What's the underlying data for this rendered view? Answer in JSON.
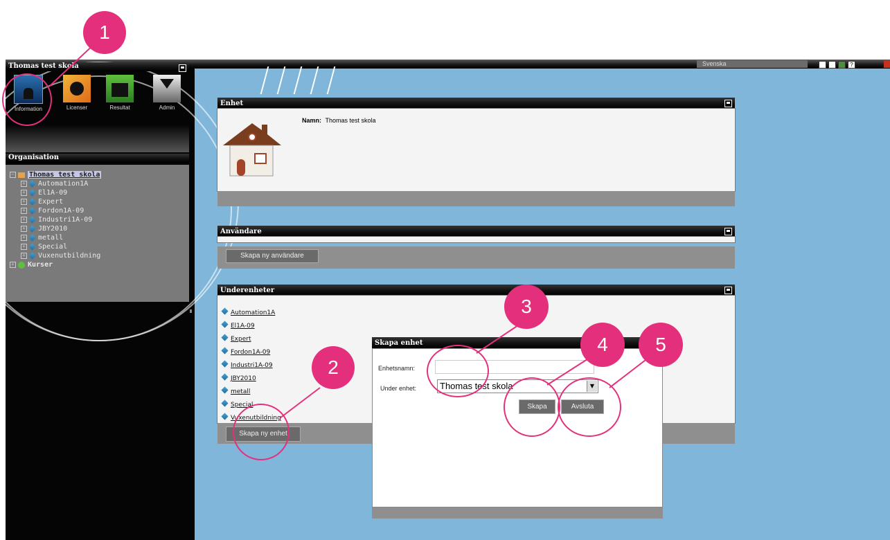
{
  "topbar": {
    "language": "Svenska"
  },
  "sidebar": {
    "school_title": "Thomas test skola",
    "apps": [
      {
        "label": "Information",
        "icon": "information-icon"
      },
      {
        "label": "Licenser",
        "icon": "licenser-icon"
      },
      {
        "label": "Resultat",
        "icon": "resultat-icon"
      },
      {
        "label": "Admin",
        "icon": "admin-icon"
      }
    ],
    "org_title": "Organisation",
    "tree_root": "Thomas test skola",
    "tree_items": [
      "Automation1A",
      "El1A-09",
      "Expert",
      "Fordon1A-09",
      "Industri1A-09",
      "JBY2010",
      "metall",
      "Special",
      "Vuxenutbildning"
    ],
    "tree_kurser": "Kurser"
  },
  "enhet": {
    "title": "Enhet",
    "name_label": "Namn:",
    "name_value": "Thomas test skola"
  },
  "anvandare": {
    "title": "Användare",
    "create_button": "Skapa ny användare"
  },
  "underenheter": {
    "title": "Underenheter",
    "items": [
      "Automation1A",
      "El1A-09",
      "Expert",
      "Fordon1A-09",
      "Industri1A-09",
      "JBY2010",
      "metall",
      "Special",
      "Vuxenutbildning"
    ],
    "create_button": "Skapa ny enhet"
  },
  "dialog": {
    "title": "Skapa enhet",
    "name_label": "Enhetsnamn:",
    "name_value": "",
    "parent_label": "Under enhet:",
    "parent_value": "Thomas test skola",
    "create_button": "Skapa",
    "cancel_button": "Avsluta"
  },
  "callouts": [
    "1",
    "2",
    "3",
    "4",
    "5"
  ],
  "colors": {
    "accent": "#e4307c",
    "background": "#7fb6d9"
  }
}
